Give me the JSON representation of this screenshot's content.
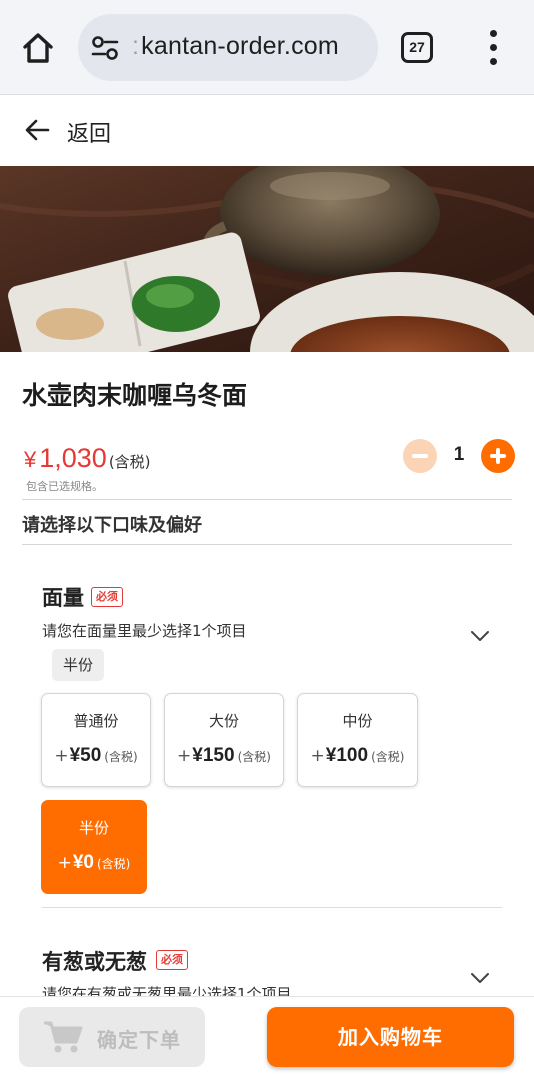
{
  "browser": {
    "url": "kantan-order.com",
    "tab_count": "27",
    "icons": [
      "home-icon",
      "site-settings-icon",
      "tab-switcher-icon",
      "more-vert-icon"
    ]
  },
  "nav": {
    "back_label": "返回",
    "icon": "arrow-left-icon"
  },
  "product": {
    "name": "水壶肉末咖喱乌冬面",
    "currency": "¥",
    "price": "1,030",
    "tax_label": "(含税)",
    "price_note": "包含已选规格。",
    "quantity": "1"
  },
  "preferences_heading": "请选择以下口味及偏好",
  "option_groups": [
    {
      "title": "面量",
      "required_label": "必须",
      "description": "请您在面量里最少选择1个项目",
      "selected_summary": "半份",
      "options": [
        {
          "name": "普通份",
          "plus": "+",
          "price": "¥50",
          "tax": "(含税)",
          "selected": false
        },
        {
          "name": "大份",
          "plus": "+",
          "price": "¥150",
          "tax": "(含税)",
          "selected": false
        },
        {
          "name": "中份",
          "plus": "+",
          "price": "¥100",
          "tax": "(含税)",
          "selected": false
        },
        {
          "name": "半份",
          "plus": "+",
          "price": "¥0",
          "tax": "(含税)",
          "selected": true
        }
      ]
    },
    {
      "title": "有葱或无葱",
      "required_label": "必须",
      "description": "请您在有葱或无葱里最少选择1个项目"
    }
  ],
  "bottom_bar": {
    "confirm_label": "确定下单",
    "add_to_cart_label": "加入购物车"
  },
  "colors": {
    "accent": "#ff6d00",
    "price": "#e53935",
    "required": "#e53935",
    "disabled_bg": "#e9e9e9"
  }
}
